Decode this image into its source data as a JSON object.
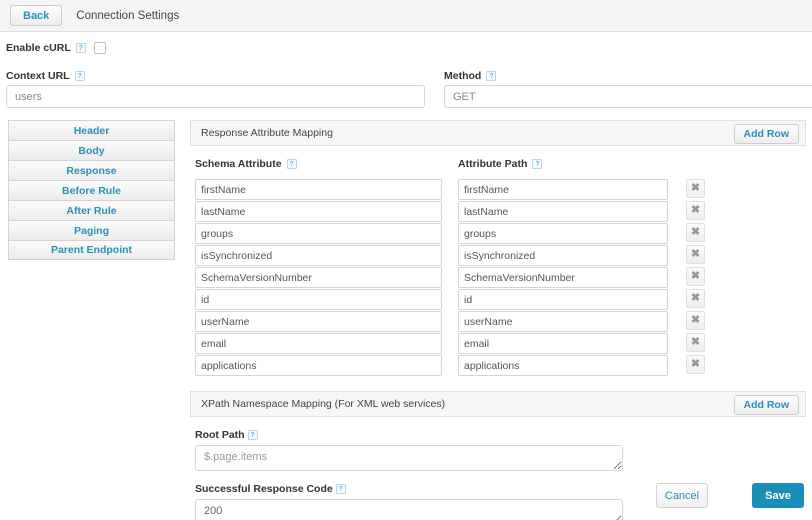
{
  "topbar": {
    "back_label": "Back",
    "title": "Connection Settings"
  },
  "form": {
    "enable_curl_label": "Enable cURL",
    "enable_curl_checked": false,
    "context_url_label": "Context URL",
    "context_url_value": "users",
    "method_label": "Method",
    "method_value": "GET",
    "help_glyph": "?"
  },
  "tabs": [
    {
      "label": "Header"
    },
    {
      "label": "Body"
    },
    {
      "label": "Response"
    },
    {
      "label": "Before Rule"
    },
    {
      "label": "After Rule"
    },
    {
      "label": "Paging"
    },
    {
      "label": "Parent Endpoint"
    }
  ],
  "response_mapping": {
    "section_title": "Response Attribute Mapping",
    "add_row_label": "Add Row",
    "col_schema_attribute": "Schema Attribute",
    "col_attribute_path": "Attribute Path",
    "delete_glyph": "✖",
    "rows": [
      {
        "schema_attribute": "firstName",
        "attribute_path": "firstName"
      },
      {
        "schema_attribute": "lastName",
        "attribute_path": "lastName"
      },
      {
        "schema_attribute": "groups",
        "attribute_path": "groups"
      },
      {
        "schema_attribute": "isSynchronized",
        "attribute_path": "isSynchronized"
      },
      {
        "schema_attribute": "SchemaVersionNumber",
        "attribute_path": "SchemaVersionNumber"
      },
      {
        "schema_attribute": "id",
        "attribute_path": "id"
      },
      {
        "schema_attribute": "userName",
        "attribute_path": "userName"
      },
      {
        "schema_attribute": "email",
        "attribute_path": "email"
      },
      {
        "schema_attribute": "applications",
        "attribute_path": "applications"
      }
    ]
  },
  "xpath_mapping": {
    "section_title": "XPath Namespace Mapping (For XML web services)",
    "add_row_label": "Add Row",
    "root_path_label": "Root Path",
    "root_path_value": "$.page.items",
    "response_code_label": "Successful Response Code",
    "response_code_value": "200"
  },
  "footer": {
    "cancel_label": "Cancel",
    "save_label": "Save"
  },
  "colors": {
    "accent_blue": "#2a90b8",
    "save_blue": "#1b8eb7",
    "panel_bg": "#f6f6f6",
    "border": "#d6d6d6"
  }
}
